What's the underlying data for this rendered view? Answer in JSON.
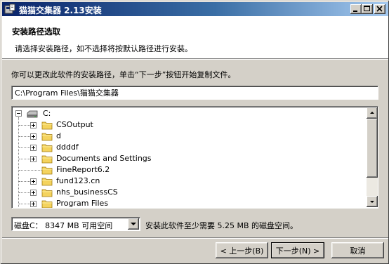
{
  "window": {
    "title": "猫猫交集器  2.13安装"
  },
  "header": {
    "title": "安装路径选取",
    "subtitle": "请选择安装路径，如不选择将按默认路径进行安装。"
  },
  "instruction": "你可以更改此软件的安装路径，单击“下一步”按钮开始复制文件。",
  "path_input": {
    "value": "C:\\Program Files\\猫猫交集器"
  },
  "tree": {
    "root": "C:",
    "items": [
      {
        "label": "CSOutput",
        "expandable": true
      },
      {
        "label": "d",
        "expandable": true
      },
      {
        "label": "ddddf",
        "expandable": true
      },
      {
        "label": "Documents and Settings",
        "expandable": true
      },
      {
        "label": "FineReport6.2",
        "expandable": false
      },
      {
        "label": "fund123.cn",
        "expandable": true
      },
      {
        "label": "nhs_businessCS",
        "expandable": true
      },
      {
        "label": "Program Files",
        "expandable": true
      }
    ]
  },
  "drive_select": {
    "selected": "磁盘C： 8347 MB 可用空间"
  },
  "space_required": "安装此软件至少需要 5.25 MB 的磁盘空间。",
  "buttons": {
    "back": "< 上一步(B)",
    "next": "下一步(N) >",
    "cancel": "取消"
  },
  "colors": {
    "titlebar_start": "#0a246a",
    "titlebar_end": "#a6caf0",
    "face": "#d4d0c8",
    "folder": "#f4d35e"
  }
}
